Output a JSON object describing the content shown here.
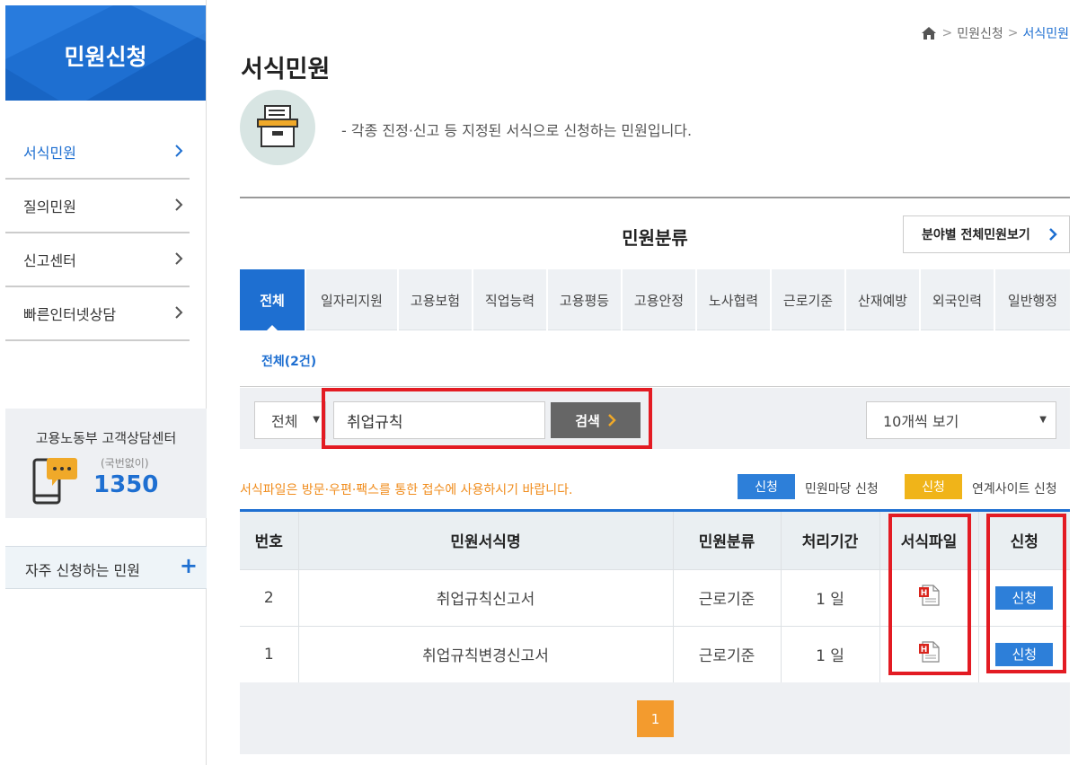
{
  "sidebar": {
    "title": "민원신청",
    "menu": [
      {
        "label": "서식민원"
      },
      {
        "label": "질의민원"
      },
      {
        "label": "신고센터"
      },
      {
        "label": "빠른인터넷상담"
      }
    ],
    "support": {
      "title": "고용노동부 고객상담센터",
      "sub": "(국번없이)",
      "number": "1350"
    },
    "frequent_label": "자주 신청하는 민원",
    "plus": "+"
  },
  "breadcrumb": {
    "home_icon": "home-icon",
    "items": [
      "민원신청",
      "서식민원"
    ]
  },
  "page": {
    "title": "서식민원",
    "intro": "- 각종 진정·신고 등 지정된 서식으로 신청하는 민원입니다."
  },
  "category": {
    "title": "민원분류",
    "view_all": "분야별 전체민원보기",
    "tabs": [
      "전체",
      "일자리지원",
      "고용보험",
      "직업능력",
      "고용평등",
      "고용안정",
      "노사협력",
      "근로기준",
      "산재예방",
      "외국인력",
      "일반행정"
    ],
    "count_label": "전체(2건)"
  },
  "search": {
    "category_selected": "전체",
    "query": "취업규칙",
    "button": "검색",
    "page_size": "10개씩 보기"
  },
  "notice": "서식파일은 방문·우편·팩스를 통한 접수에 사용하시기 바랍니다.",
  "legend": [
    {
      "badge": "신청",
      "label": "민원마당 신청",
      "color": "#2d7fd9"
    },
    {
      "badge": "신청",
      "label": "연계사이트 신청",
      "color": "#f0b419"
    }
  ],
  "table": {
    "headers": [
      "번호",
      "민원서식명",
      "민원분류",
      "처리기간",
      "서식파일",
      "신청"
    ],
    "rows": [
      {
        "no": "2",
        "name": "취업규칙신고서",
        "category": "근로기준",
        "period": "1 일",
        "file_icon": "hwp-file-icon",
        "apply": "신청"
      },
      {
        "no": "1",
        "name": "취업규칙변경신고서",
        "category": "근로기준",
        "period": "1 일",
        "file_icon": "hwp-file-icon",
        "apply": "신청"
      }
    ]
  },
  "pagination": {
    "current": "1"
  },
  "colors": {
    "primary": "#1e6fd1",
    "highlight": "#e31b23",
    "orange": "#f39b2e"
  }
}
